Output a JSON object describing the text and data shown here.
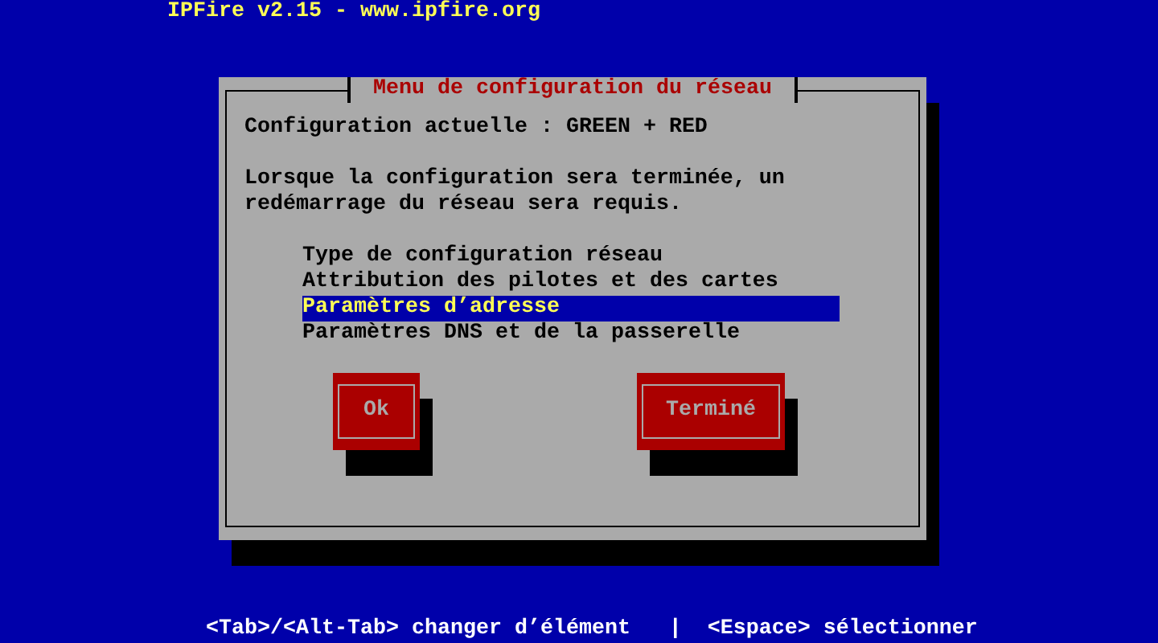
{
  "top_title": "IPFire v2.15 - www.ipfire.org",
  "dialog": {
    "title": "Menu de configuration du réseau",
    "status": "Configuration actuelle : GREEN + RED",
    "message": "Lorsque la configuration sera terminée, un redémarrage du réseau sera requis.",
    "menu": [
      {
        "label": "Type de configuration réseau",
        "selected": false
      },
      {
        "label": "Attribution des pilotes et des cartes",
        "selected": false
      },
      {
        "label": "Paramètres d’adresse",
        "selected": true
      },
      {
        "label": "Paramètres DNS et de la passerelle",
        "selected": false
      }
    ],
    "buttons": [
      "Ok",
      "Terminé"
    ]
  },
  "help_bar": "<Tab>/<Alt-Tab> changer d’élément   |  <Espace> sélectionner"
}
